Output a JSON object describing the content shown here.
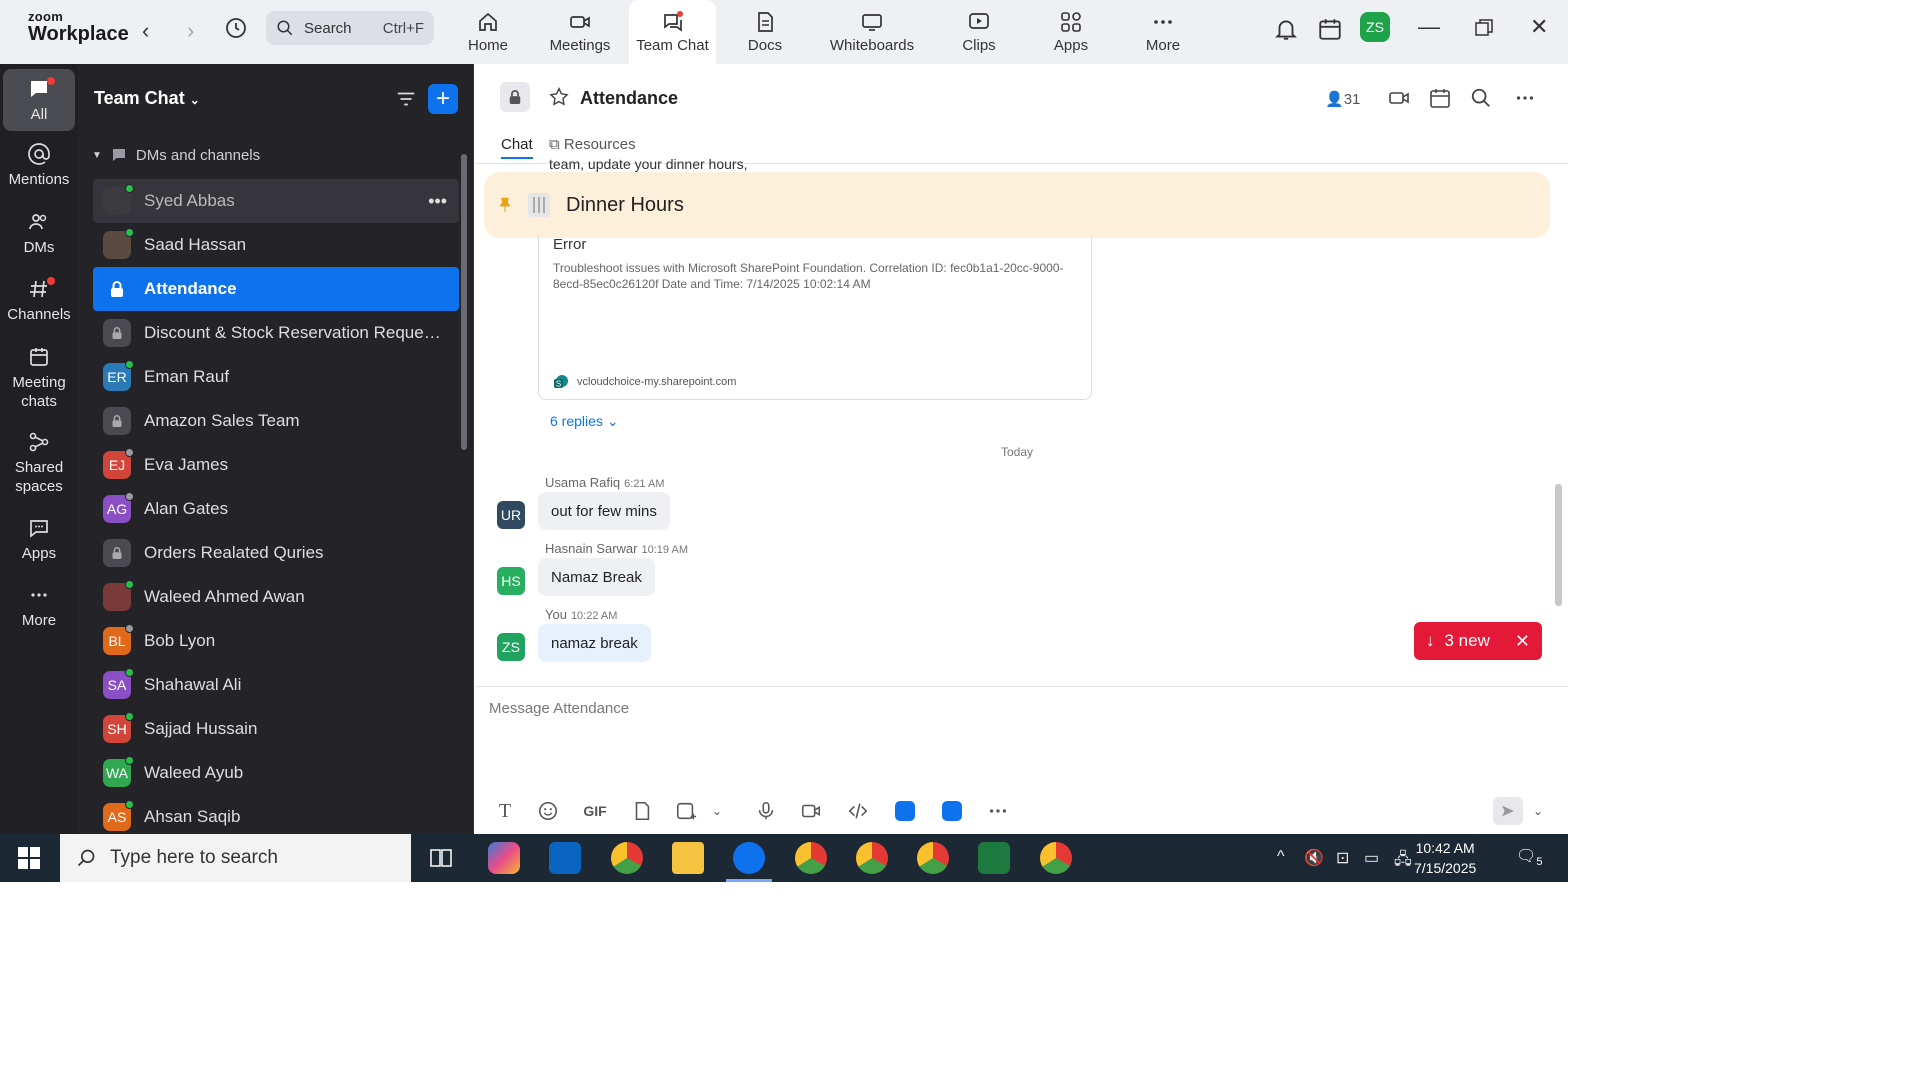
{
  "app": {
    "brand_top": "zoom",
    "brand_bottom": "Workplace"
  },
  "search": {
    "placeholder": "Search",
    "shortcut": "Ctrl+F"
  },
  "nav_tabs": [
    {
      "label": "Home"
    },
    {
      "label": "Meetings"
    },
    {
      "label": "Team Chat"
    },
    {
      "label": "Docs"
    },
    {
      "label": "Whiteboards"
    },
    {
      "label": "Clips"
    },
    {
      "label": "Apps"
    },
    {
      "label": "More"
    }
  ],
  "user": {
    "initials": "ZS"
  },
  "rail": [
    {
      "label": "All"
    },
    {
      "label": "Mentions"
    },
    {
      "label": "DMs"
    },
    {
      "label": "Channels"
    },
    {
      "label": "Meeting chats"
    },
    {
      "label": "Shared spaces"
    },
    {
      "label": "Apps"
    },
    {
      "label": "More"
    }
  ],
  "panel": {
    "title": "Team Chat",
    "section": "DMs and channels",
    "items": [
      {
        "name": "Syed Abbas",
        "initials": "",
        "color": "#3a3a3f"
      },
      {
        "name": "Saad Hassan",
        "initials": "",
        "color": "#5a4a40"
      },
      {
        "name": "Attendance",
        "initials": "",
        "color": "#0e72ed"
      },
      {
        "name": "Discount & Stock Reservation Requests O...",
        "initials": "",
        "color": "#4a4a50"
      },
      {
        "name": "Eman Rauf",
        "initials": "ER",
        "color": "#2a7ab8"
      },
      {
        "name": "Amazon Sales Team",
        "initials": "",
        "color": "#4a4a50"
      },
      {
        "name": "Eva James",
        "initials": "EJ",
        "color": "#d2453a"
      },
      {
        "name": "Alan Gates",
        "initials": "AG",
        "color": "#8a4fc4"
      },
      {
        "name": "Orders Realated Quries",
        "initials": "",
        "color": "#4a4a50"
      },
      {
        "name": "Waleed Ahmed Awan",
        "initials": "",
        "color": "#7a3a3a"
      },
      {
        "name": "Bob Lyon",
        "initials": "BL",
        "color": "#e06a1a"
      },
      {
        "name": "Shahawal Ali",
        "initials": "SA",
        "color": "#8a4fc4"
      },
      {
        "name": "Sajjad Hussain",
        "initials": "SH",
        "color": "#d2453a"
      },
      {
        "name": "Waleed Ayub",
        "initials": "WA",
        "color": "#2fa84f"
      },
      {
        "name": "Ahsan Saqib",
        "initials": "AS",
        "color": "#e06a1a"
      }
    ]
  },
  "chat": {
    "title": "Attendance",
    "member_count": "31",
    "tabs": {
      "chat": "Chat",
      "resources": "Resources"
    },
    "top_snippet": "team, update your dinner hours,",
    "pinned": "Dinner Hours",
    "card": {
      "title": "Error",
      "desc": "Troubleshoot issues with Microsoft SharePoint Foundation. Correlation ID: fec0b1a1-20cc-9000-8ecd-85ec0c26120f Date and Time: 7/14/2025 10:02:14 AM",
      "domain": "vcloudchoice-my.sharepoint.com"
    },
    "replies": "6 replies",
    "divider": "Today",
    "messages": [
      {
        "initials": "UR",
        "color": "#2f4a5e",
        "sender": "Usama Rafiq",
        "time": "6:21 AM",
        "text": "out for few mins"
      },
      {
        "initials": "HS",
        "color": "#27ae60",
        "sender": "Hasnain Sarwar",
        "time": "10:19 AM",
        "text": "Namaz Break"
      },
      {
        "initials": "ZS",
        "color": "#1fa35f",
        "sender": "You",
        "time": "10:22 AM",
        "text": "namaz break"
      }
    ],
    "new_pill": "3 new",
    "composer_placeholder": "Message Attendance",
    "gif_label": "GIF"
  },
  "taskbar": {
    "search_placeholder": "Type here to search",
    "time": "10:42 AM",
    "date": "7/15/2025",
    "notif_count": "5"
  },
  "colors": {
    "accent": "#0e72ed",
    "rail_bg": "#1f1f24",
    "panel_bg": "#242428",
    "pinned_bg": "#fdf0da",
    "new_pill": "#e31937"
  }
}
